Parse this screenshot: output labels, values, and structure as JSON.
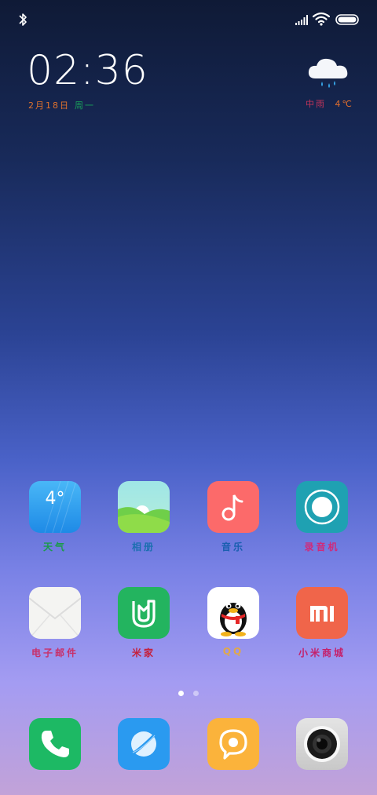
{
  "status_bar": {
    "icons": [
      "bluetooth-icon",
      "cellular-signal-icon",
      "wifi-icon",
      "battery-icon"
    ]
  },
  "clock": {
    "time": "02:36",
    "date_parts": [
      "2月18日",
      "周一"
    ],
    "date_colors": [
      "#e0722d",
      "#19a35b"
    ]
  },
  "weather": {
    "icon": "cloud-rain-icon",
    "condition": "中雨",
    "temperature": "4℃",
    "condition_color": "#c2345a",
    "temp_color": "#e36f2d"
  },
  "apps": {
    "weather": {
      "label": "天气",
      "icon_text": "4°",
      "label_color": "#1b9a4b"
    },
    "gallery": {
      "label": "相册",
      "label_color": "#1c6fb0"
    },
    "music": {
      "label": "音乐",
      "label_color": "#1a5fb0"
    },
    "recorder": {
      "label": "录音机",
      "label_color": "#d02a7a"
    },
    "email": {
      "label": "电子邮件",
      "label_color": "#c8306a"
    },
    "mi_home": {
      "label": "米家",
      "label_color": "#c51f3a"
    },
    "qq": {
      "label": "QQ",
      "label_color": "#e0a84a"
    },
    "mi_store": {
      "label": "小米商城",
      "label_color": "#c5206a"
    }
  },
  "dock": [
    "phone-icon",
    "browser-icon",
    "messages-icon",
    "camera-icon"
  ],
  "page_indicator": {
    "count": 2,
    "active": 0
  }
}
